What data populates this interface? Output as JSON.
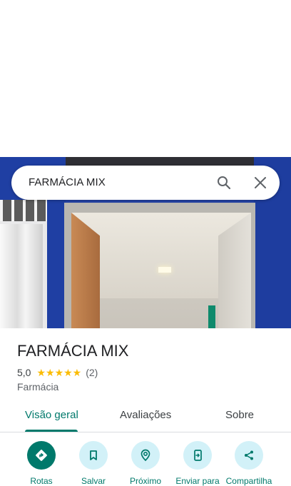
{
  "search": {
    "query": "FARMÁCIA MIX"
  },
  "place": {
    "name": "FARMÁCIA MIX",
    "rating": "5,0",
    "stars": "★★★★★",
    "review_count": "(2)",
    "category": "Farmácia"
  },
  "tabs": [
    {
      "label": "Visão geral",
      "active": true
    },
    {
      "label": "Avaliações",
      "active": false
    },
    {
      "label": "Sobre",
      "active": false
    }
  ],
  "actions": [
    {
      "label": "Rotas",
      "icon": "directions-icon"
    },
    {
      "label": "Salvar",
      "icon": "bookmark-icon"
    },
    {
      "label": "Próximo",
      "icon": "nearby-icon"
    },
    {
      "label": "Enviar para",
      "icon": "send-to-phone-icon"
    },
    {
      "label": "Compartilha",
      "icon": "share-icon"
    }
  ],
  "colors": {
    "accent": "#00796b",
    "chip_bg": "#d2f1f8",
    "star": "#fbbc04"
  }
}
